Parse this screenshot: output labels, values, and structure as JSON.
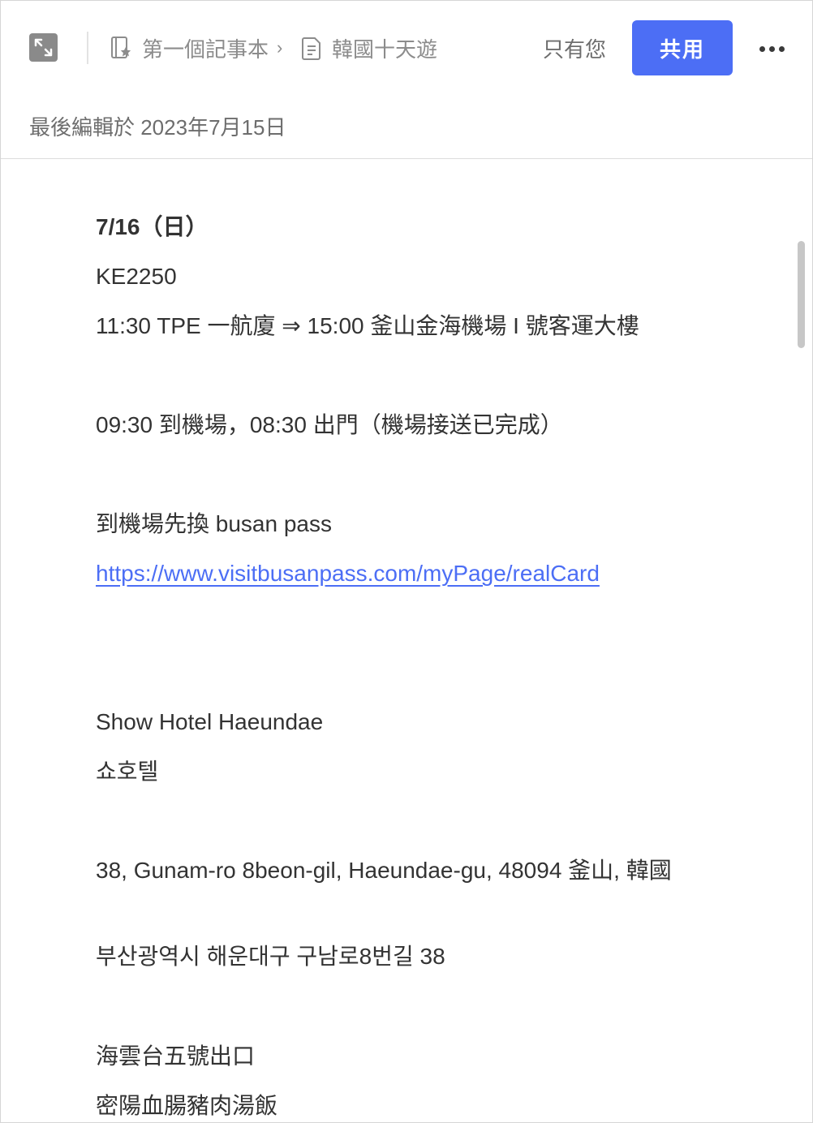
{
  "header": {
    "breadcrumb": {
      "notebook": "第一個記事本",
      "separator": "›",
      "note": "韓國十天遊"
    },
    "visibility": "只有您",
    "share_label": "共用",
    "icons": {
      "expand": "expand-icon",
      "notebook": "notebook-icon",
      "note": "note-icon",
      "more": "more-icon"
    }
  },
  "meta": {
    "last_edited": "最後編輯於 2023年7月15日"
  },
  "colors": {
    "accent": "#4c6ef5",
    "link": "#4c6ef5",
    "text": "#333333",
    "muted": "#8c8c8c"
  },
  "note": {
    "lines": [
      {
        "text": "7/16（日）",
        "bold": true
      },
      {
        "text": "KE2250"
      },
      {
        "text": "11:30 TPE 一航廈 ⇒ 15:00 釜山金海機場 I 號客運大樓"
      },
      {
        "text": "09:30 到機場，08:30 出門（機場接送已完成）"
      },
      {
        "text": "到機場先換 busan pass"
      },
      {
        "text": "https://www.visitbusanpass.com/myPage/realCard",
        "link": true
      },
      {
        "text": "Show Hotel Haeundae"
      },
      {
        "text": "쇼호텔"
      },
      {
        "text": "38, Gunam-ro 8beon-gil, Haeundae-gu, 48094 釜山, 韓國"
      },
      {
        "text": "부산광역시 해운대구 구남로8번길 38"
      },
      {
        "text": "海雲台五號出口"
      },
      {
        "text": "密陽血腸豬肉湯飯"
      }
    ]
  }
}
